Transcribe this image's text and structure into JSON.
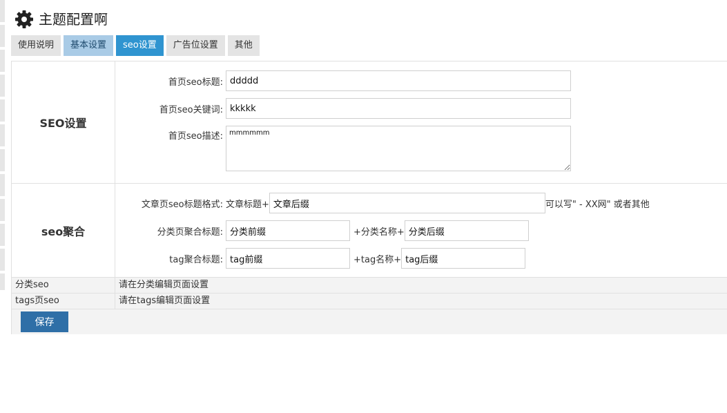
{
  "header": {
    "title": "主题配置啊",
    "icon": "gear-icon"
  },
  "tabs": [
    {
      "label": "使用说明",
      "state": "inactive"
    },
    {
      "label": "基本设置",
      "state": "light"
    },
    {
      "label": "seo设置",
      "state": "active"
    },
    {
      "label": "广告位设置",
      "state": "inactive"
    },
    {
      "label": "其他",
      "state": "inactive"
    }
  ],
  "seo": {
    "heading": "SEO设置",
    "home_title": {
      "label": "首页seo标题:",
      "value": "ddddd"
    },
    "home_keywords": {
      "label": "首页seo关键词:",
      "value": "kkkkk"
    },
    "home_desc": {
      "label": "首页seo描述:",
      "value": "mmmmmm"
    }
  },
  "aggregate": {
    "heading": "seo聚合",
    "article": {
      "label": "文章页seo标题格式:",
      "prefix_text": "文章标题+",
      "suffix_value": "文章后缀",
      "hint": "可以写\" - XX网\" 或者其他"
    },
    "category": {
      "label": "分类页聚合标题:",
      "prefix_value": "分类前缀",
      "middle_text": "+分类名称+",
      "suffix_value": "分类后缀"
    },
    "tag": {
      "label": "tag聚合标题:",
      "prefix_value": "tag前缀",
      "middle_text": "+tag名称+",
      "suffix_value": "tag后缀"
    }
  },
  "rows": [
    {
      "name": "分类seo",
      "note": "请在分类编辑页面设置"
    },
    {
      "name": "tags页seo",
      "note": "请在tags编辑页面设置"
    }
  ],
  "save_label": "保存",
  "colors": {
    "active_tab": "#2f94d0",
    "light_tab": "#a9cbe6",
    "save_button": "#2f6fa7"
  }
}
